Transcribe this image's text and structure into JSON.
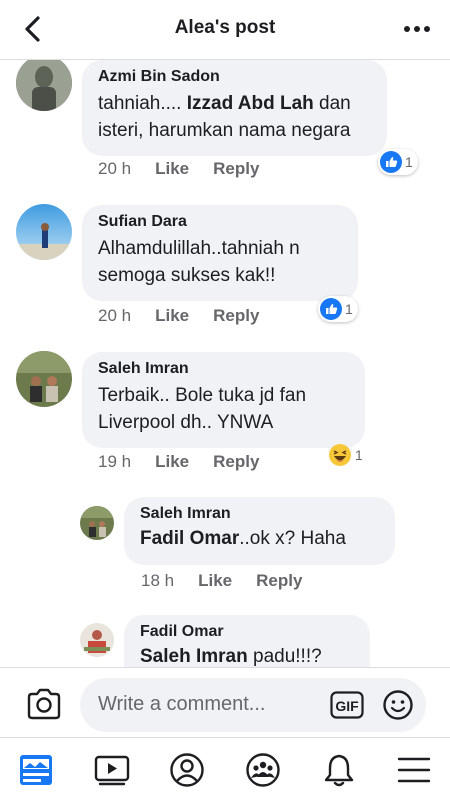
{
  "header": {
    "title": "Alea's post"
  },
  "comments": [
    {
      "name": "Azmi Bin Sadon",
      "text_plain": "tahniah....",
      "mention": "Izzad Abd Lah",
      "text_after": "dan isteri, harumkan nama negara",
      "time": "20 h",
      "like": "Like",
      "reply": "Reply",
      "reaction": "like",
      "reaction_count": "1"
    },
    {
      "name": "Sufian Dara",
      "text": "Alhamdulillah..tahniah n semoga sukses kak!!",
      "time": "20 h",
      "like": "Like",
      "reply": "Reply",
      "reaction": "like",
      "reaction_count": "1"
    },
    {
      "name": "Saleh Imran",
      "text": "Terbaik.. Bole tuka jd fan Liverpool dh.. YNWA",
      "time": "19 h",
      "like": "Like",
      "reply": "Reply",
      "reaction": "haha",
      "reaction_count": "1"
    }
  ],
  "replies": [
    {
      "name": "Saleh Imran",
      "mention": "Fadil Omar",
      "text_after": "..ok x? Haha",
      "time": "18 h",
      "like": "Like",
      "reply": "Reply"
    },
    {
      "name": "Fadil Omar",
      "mention": "Saleh Imran",
      "text_after": "padu!!!?"
    }
  ],
  "composer": {
    "placeholder": "Write a comment..."
  },
  "gif_label": "GIF",
  "icons": {
    "back": "chevron-left-icon",
    "more": "more-dots-icon",
    "camera": "camera-icon",
    "gif": "gif-icon",
    "emoji": "emoji-icon",
    "news_feed": "news-feed-icon",
    "watch": "watch-icon",
    "profile": "profile-icon",
    "groups": "groups-icon",
    "notifications": "bell-icon",
    "menu": "menu-icon"
  },
  "colors": {
    "accent": "#1877f2",
    "secondary_text": "#65676b",
    "bubble": "#f0f2f5"
  }
}
